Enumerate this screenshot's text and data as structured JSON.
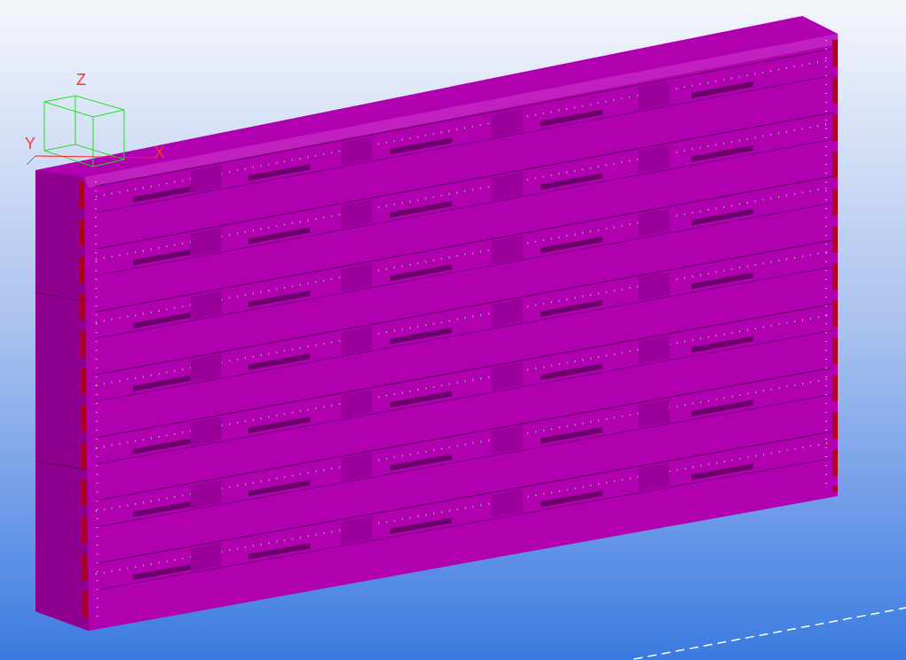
{
  "axes": {
    "z_label": "Z",
    "y_label": "Y",
    "x_label": "X"
  }
}
